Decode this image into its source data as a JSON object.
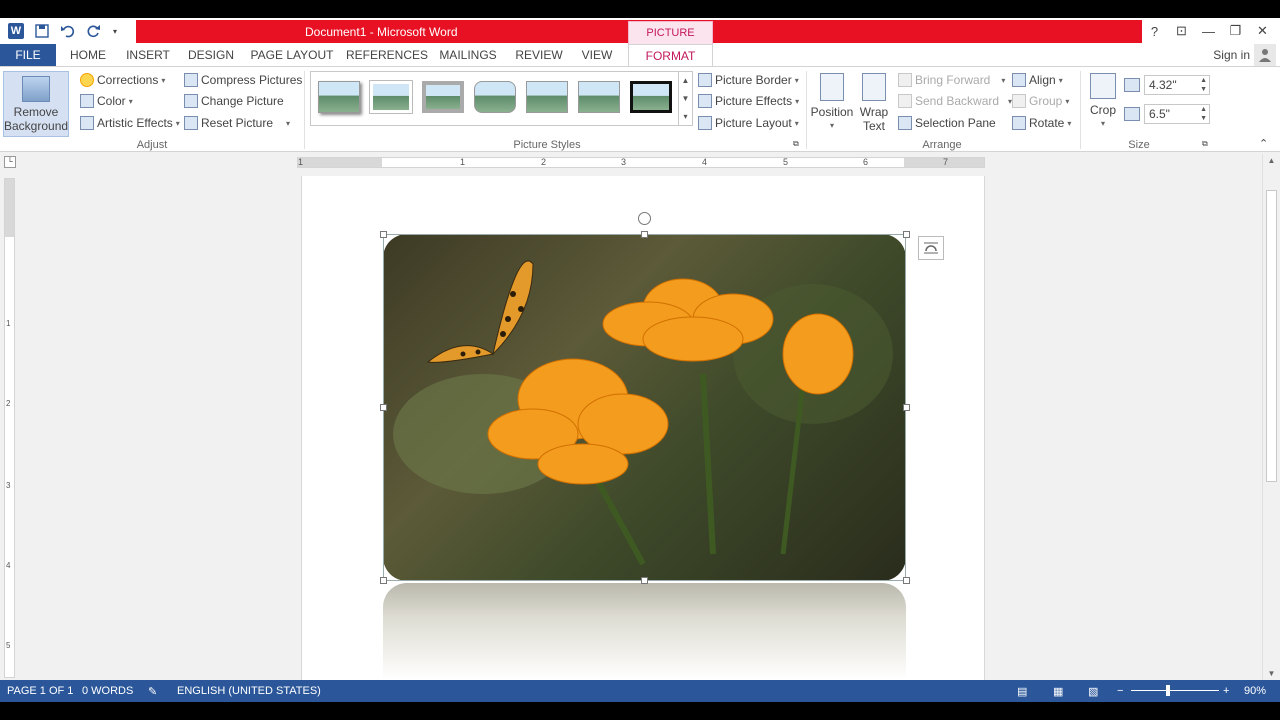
{
  "window": {
    "title": "Document1 - Microsoft Word",
    "context_tab_group": "PICTURE TOOLS",
    "sign_in": "Sign in",
    "help": "?",
    "controls": [
      "⊡",
      "—",
      "❐",
      "✕"
    ]
  },
  "tabs": [
    "FILE",
    "HOME",
    "INSERT",
    "DESIGN",
    "PAGE LAYOUT",
    "REFERENCES",
    "MAILINGS",
    "REVIEW",
    "VIEW",
    "FORMAT"
  ],
  "ribbon": {
    "adjust": {
      "label": "Adjust",
      "remove_background": "Remove Background",
      "corrections": "Corrections",
      "color": "Color",
      "artistic_effects": "Artistic Effects",
      "compress_pictures": "Compress Pictures",
      "change_picture": "Change Picture",
      "reset_picture": "Reset Picture"
    },
    "picture_styles": {
      "label": "Picture Styles",
      "picture_border": "Picture Border",
      "picture_effects": "Picture Effects",
      "picture_layout": "Picture Layout"
    },
    "arrange": {
      "label": "Arrange",
      "position": "Position",
      "wrap_text": "Wrap Text",
      "bring_forward": "Bring Forward",
      "send_backward": "Send Backward",
      "selection_pane": "Selection Pane",
      "align": "Align",
      "group": "Group",
      "rotate": "Rotate"
    },
    "size": {
      "label": "Size",
      "crop": "Crop",
      "height": "4.32\"",
      "width": "6.5\""
    }
  },
  "ruler": {
    "numbers": [
      "1",
      "1",
      "2",
      "3",
      "4",
      "5",
      "6",
      "7"
    ],
    "vnumbers": [
      "1",
      "2",
      "3",
      "4",
      "5"
    ]
  },
  "status": {
    "page": "PAGE 1 OF 1",
    "words": "0 WORDS",
    "language": "ENGLISH (UNITED STATES)",
    "zoom": "90%"
  },
  "colors": {
    "brand": "#2b579a",
    "title_accent": "#e81123",
    "context_tab": "#c2185b"
  }
}
